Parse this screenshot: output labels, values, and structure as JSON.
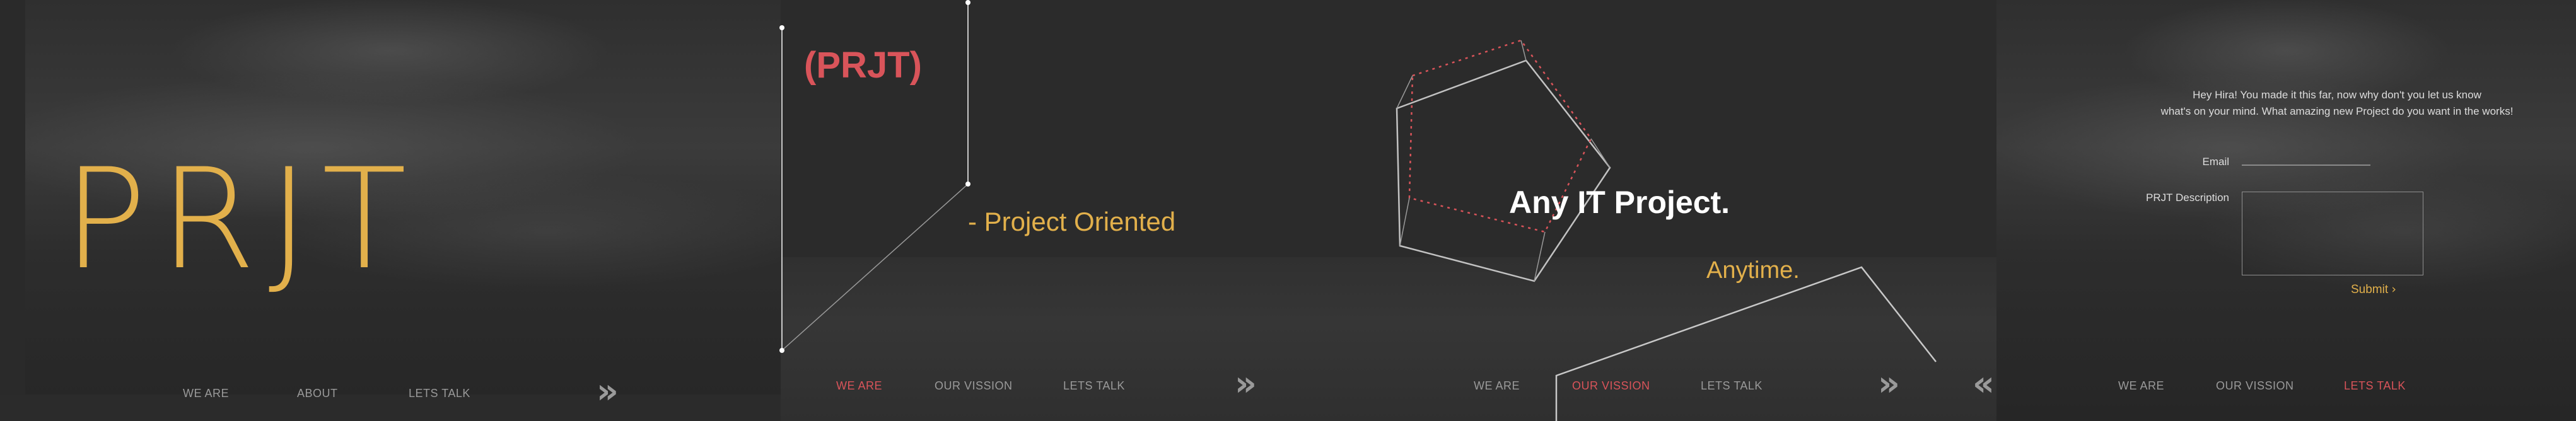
{
  "slide1": {
    "logo_text": "PRJT",
    "nav": [
      "WE ARE",
      "ABOUT",
      "LETS TALK"
    ],
    "next_icon": "double-chevron-right-icon"
  },
  "slide2": {
    "brand": "(PRJT)",
    "tagline": "- Project Oriented",
    "nav": [
      "WE ARE",
      "OUR VISSION",
      "LETS TALK"
    ],
    "active": "WE ARE",
    "next_icon": "double-chevron-right-icon"
  },
  "slide3": {
    "headline": "Any IT Project.",
    "subline": "Anytime.",
    "nav": [
      "WE ARE",
      "OUR VISSION",
      "LETS TALK"
    ],
    "active": "OUR VISSION",
    "next_icon": "double-chevron-right-icon"
  },
  "slide4": {
    "message_line1": "Hey Hira! You made it this far, now why don't you let us know",
    "message_line2": "what's on your mind. What amazing new Project do you want in the works!",
    "email_label": "Email",
    "email_value": "",
    "description_label": "PRJT Description",
    "description_value": "",
    "submit_label": "Submit",
    "nav": [
      "WE ARE",
      "OUR VISSION",
      "LETS TALK"
    ],
    "active": "LETS TALK",
    "prev_icon": "double-chevron-left-icon"
  },
  "colors": {
    "accent_gold": "#e2b04b",
    "accent_red": "#d9545a",
    "nav_gray": "#9a9a9a",
    "background": "#2b2b2b"
  }
}
